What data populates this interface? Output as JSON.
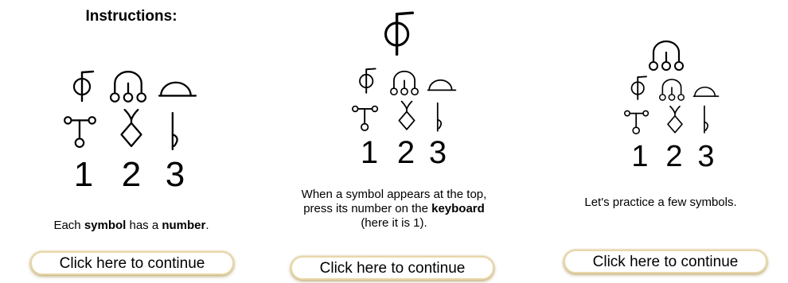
{
  "panel1": {
    "title": "Instructions:",
    "numbers": [
      "1",
      "2",
      "3"
    ],
    "caption": {
      "part1": "Each ",
      "bold1": "symbol",
      "part2": " has a ",
      "bold2": "number",
      "part3": "."
    },
    "button_label": "Click here to continue"
  },
  "panel2": {
    "numbers": [
      "1",
      "2",
      "3"
    ],
    "caption": {
      "line1": "When a symbol appears at the top,",
      "line2_part1": "press its number on the ",
      "line2_bold": "keyboard",
      "line3": "(here it is 1)."
    },
    "button_label": "Click here to continue"
  },
  "panel3": {
    "numbers": [
      "1",
      "2",
      "3"
    ],
    "caption": "Let's practice a few symbols.",
    "button_label": "Click here to continue"
  },
  "icons": {
    "row1": [
      "phi-hook-symbol",
      "three-circles-arch-symbol",
      "half-dome-symbol"
    ],
    "row2": [
      "three-circle-post-symbol",
      "diamond-horns-symbol",
      "flat-hook-symbol"
    ]
  }
}
